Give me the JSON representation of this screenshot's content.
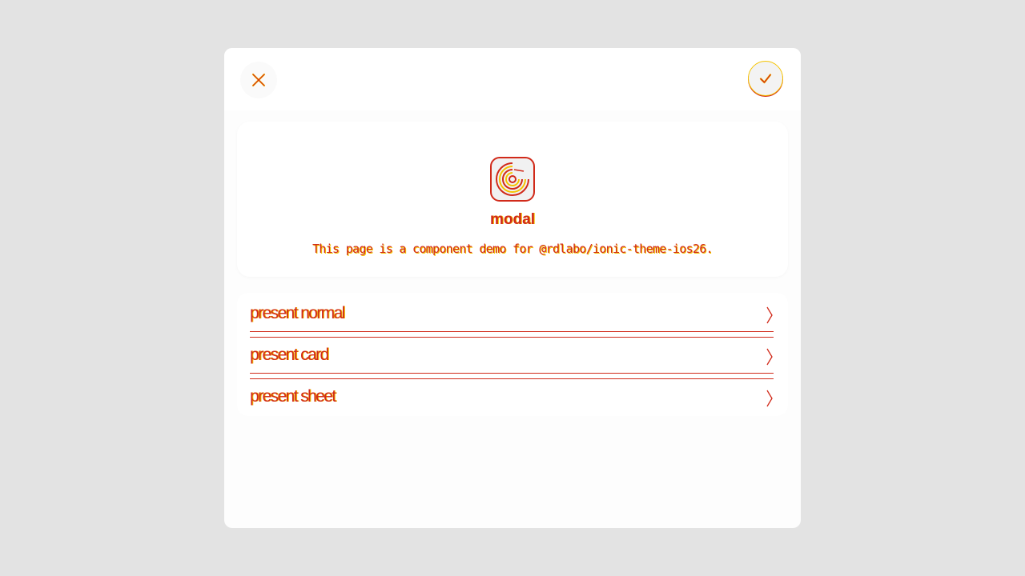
{
  "header": {
    "close_icon": "close-icon",
    "done_icon": "checkmark-icon"
  },
  "intro": {
    "icon": "target-logo-icon",
    "title": "modal",
    "description": "This page is a component demo for @rdlabo/ionic-theme-ios26."
  },
  "list": {
    "items": [
      {
        "label": "present normal",
        "icon": "chevron-forward-icon"
      },
      {
        "label": "present card",
        "icon": "chevron-forward-icon"
      },
      {
        "label": "present sheet",
        "icon": "chevron-forward-icon"
      }
    ]
  },
  "colors": {
    "background": "#e3e3e3",
    "surface": "#ffffff",
    "accent": "#d12a1a",
    "highlight": "#f5c400"
  }
}
